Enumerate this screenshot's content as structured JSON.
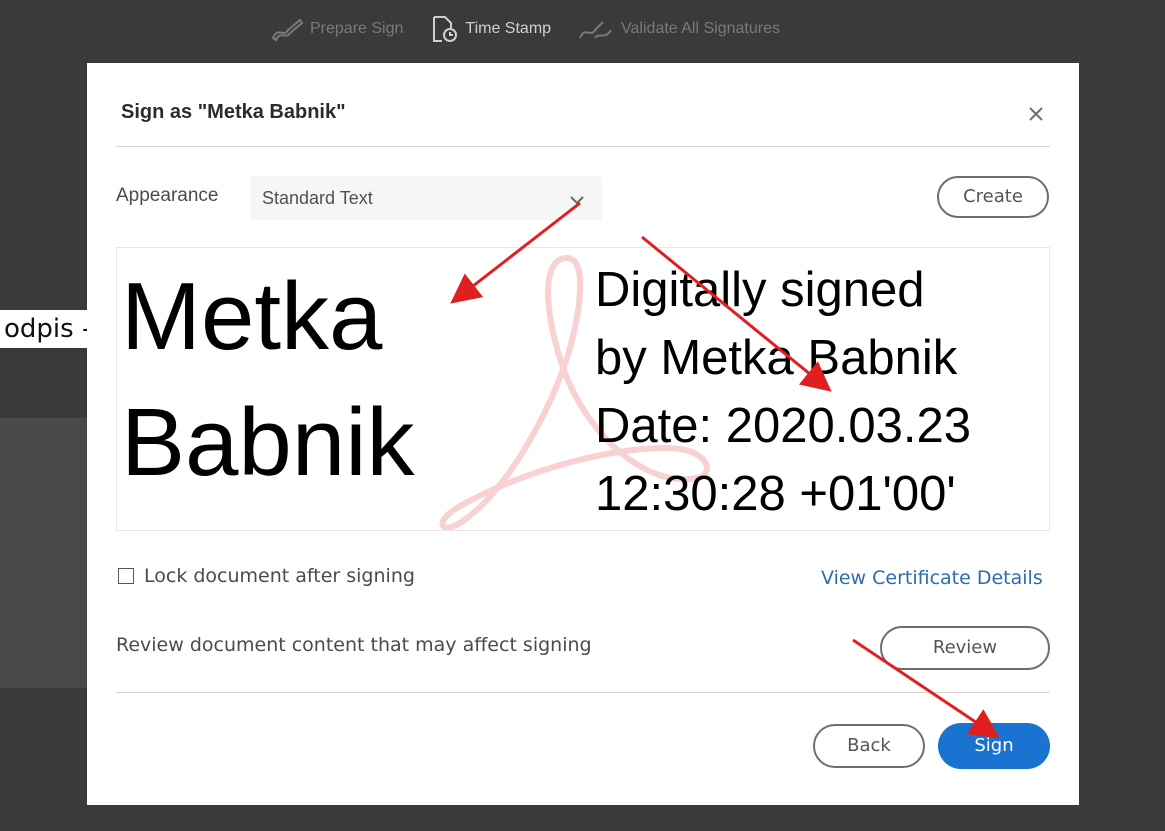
{
  "toolbar": {
    "items": [
      {
        "label": "Prepare Sign",
        "icon": "pen-icon"
      },
      {
        "label": "Time Stamp",
        "icon": "document-clock-icon"
      },
      {
        "label": "Validate All Signatures",
        "icon": "signature-icon"
      }
    ]
  },
  "background": {
    "partial_text": "odpis -"
  },
  "dialog": {
    "title": "Sign as \"Metka Babnik\"",
    "close_icon": "close-icon",
    "appearance": {
      "label": "Appearance",
      "selected": "Standard Text",
      "create_label": "Create"
    },
    "preview": {
      "name_lines": [
        "Metka",
        "Babnik"
      ],
      "detail_lines": [
        "Digitally signed",
        "by Metka Babnik",
        "Date: 2020.03.23",
        "12:30:28 +01'00'"
      ]
    },
    "lock_label": "Lock document after signing",
    "lock_checked": false,
    "certificate_link": "View Certificate Details",
    "review_text": "Review document content that may affect signing",
    "review_label": "Review",
    "back_label": "Back",
    "sign_label": "Sign"
  },
  "colors": {
    "primary": "#1a73d1",
    "link": "#2d6dad",
    "annotation_arrow": "#e02020"
  }
}
